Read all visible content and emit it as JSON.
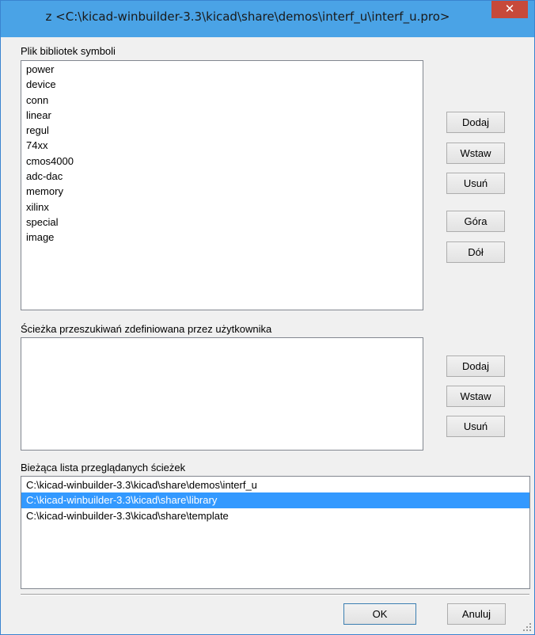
{
  "window": {
    "title": "z <C:\\kicad-winbuilder-3.3\\kicad\\share\\demos\\interf_u\\interf_u.pro>",
    "close_glyph": "✕"
  },
  "symbols": {
    "label": "Plik bibliotek symboli",
    "items": [
      "power",
      "device",
      "conn",
      "linear",
      "regul",
      "74xx",
      "cmos4000",
      "adc-dac",
      "memory",
      "xilinx",
      "special",
      "image"
    ],
    "buttons": {
      "add": "Dodaj",
      "insert": "Wstaw",
      "remove": "Usuń",
      "up": "Góra",
      "down": "Dół"
    }
  },
  "user_paths": {
    "label": "Ścieżka przeszukiwań zdefiniowana przez użytkownika",
    "buttons": {
      "add": "Dodaj",
      "insert": "Wstaw",
      "remove": "Usuń"
    }
  },
  "current_paths": {
    "label": "Bieżąca lista przeglądanych ścieżek",
    "items": [
      "C:\\kicad-winbuilder-3.3\\kicad\\share\\demos\\interf_u",
      "C:\\kicad-winbuilder-3.3\\kicad\\share\\library",
      "C:\\kicad-winbuilder-3.3\\kicad\\share\\template"
    ],
    "selected_index": 1
  },
  "footer": {
    "ok": "OK",
    "cancel": "Anuluj"
  },
  "colors": {
    "titlebar": "#4aa3e6",
    "close": "#c7493a",
    "selection": "#3399ff"
  }
}
